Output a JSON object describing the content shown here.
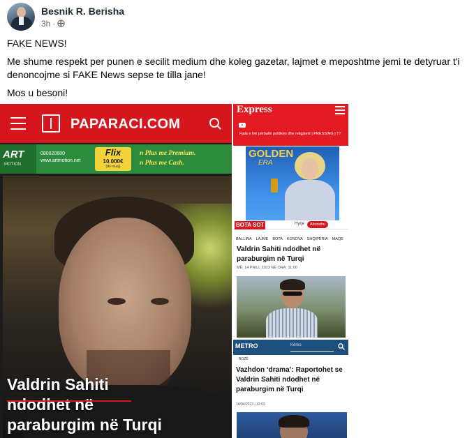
{
  "post": {
    "author": "Besnik R. Berisha",
    "time": "3h",
    "separator": "·",
    "privacy_icon": "globe-icon",
    "paragraphs": [
      "FAKE NEWS!",
      "Me shume respekt per punen e secilit medium dhe koleg gazetar, lajmet e meposhtme jemi te detyruar t'i denoncojme si FAKE News sepse te tilla jane!",
      "Mos u besoni!"
    ]
  },
  "paparaci": {
    "site_name": "PAPARACI.COM",
    "menu_icon": "hamburger-icon",
    "search_icon": "search-icon",
    "bar_color": "#d6161d",
    "ad": {
      "brand": "ART",
      "brand_sub": "MOTION",
      "phone": "080020600",
      "web": "www.artmotion.net",
      "flix": "Flix",
      "amount": "10.000€",
      "amount_note": "(do muaj)",
      "line1": "n Plus me Premium.",
      "line2": "n Plus me Cash."
    },
    "headline_lines": [
      "Valdrin Sahiti",
      "ndodhet në",
      "paraburgim në Turqi"
    ]
  },
  "express": {
    "logo": "Express",
    "tagline": "Fjala e lirë përballë politikës dhe religjionit | PRESSING | T7",
    "ad_title": "GOLDEN",
    "ad_subtitle": "ERA",
    "bar_color": "#e21b23"
  },
  "botasot": {
    "logo": "BOTA SOT",
    "login": "Hyrje",
    "subscribe": "Abonohu",
    "nav": [
      "BALLINA",
      "LAJME",
      "BOTA",
      "KOSOVA",
      "SHQIPËRIA",
      "MAQE"
    ],
    "title": "Valdrin Sahiti ndodhet në paraburgim në Turqi",
    "date": "MË: 14 PRILL 2023 NË ORA: 11:00"
  },
  "metro": {
    "logo": "METRO",
    "search_placeholder": "Kërko",
    "tag": "BOZË",
    "title": "Vazhdon ‘drama’: Raportohet se Valdrin Sahiti ndodhet në paraburgim në Turqi",
    "date": "14/04/2023 | 12:03",
    "bar_color": "#1d4f7f"
  }
}
